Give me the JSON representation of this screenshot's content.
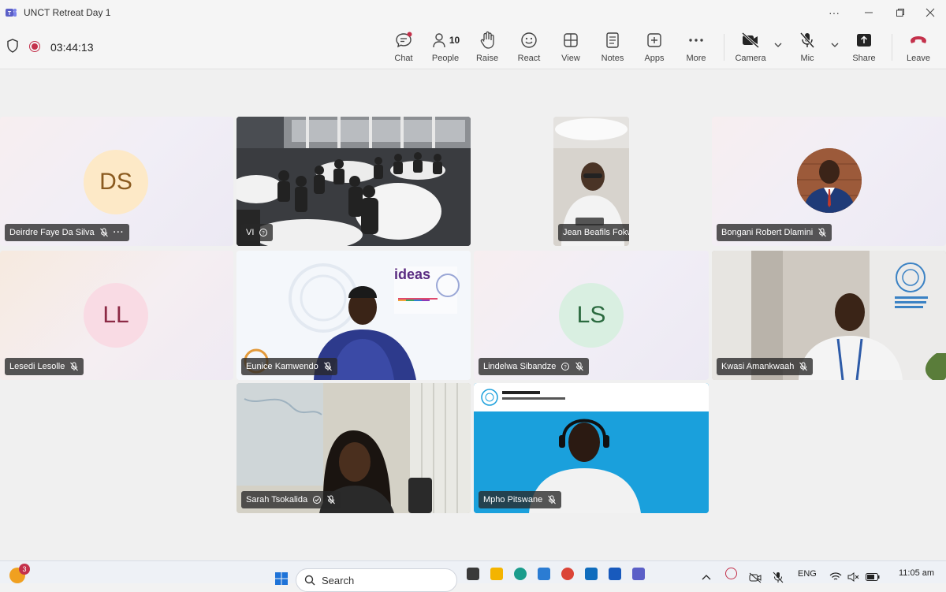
{
  "window": {
    "title": "UNCT Retreat Day 1"
  },
  "toolbar": {
    "timer": "03:44:13",
    "chat": "Chat",
    "people": "People",
    "people_count": "10",
    "raise": "Raise",
    "react": "React",
    "view": "View",
    "notes": "Notes",
    "apps": "Apps",
    "more": "More",
    "camera": "Camera",
    "mic": "Mic",
    "share": "Share",
    "leave": "Leave"
  },
  "participants": [
    {
      "name": "Deirdre Faye Da Silva",
      "initials": "DS",
      "avatar_bg": "#fde9c7",
      "avatar_fg": "#8a5a1f"
    },
    {
      "name": "VI"
    },
    {
      "name": "Jean Beafils Fokwa Tsafack"
    },
    {
      "name": "Bongani Robert Dlamini"
    },
    {
      "name": "Lesedi Lesolle",
      "initials": "LL",
      "avatar_bg": "#f9dbe4",
      "avatar_fg": "#8c2a45"
    },
    {
      "name": "Eunice Kamwendo"
    },
    {
      "name": "Lindelwa Sibandze",
      "initials": "LS",
      "avatar_bg": "#d9efe1",
      "avatar_fg": "#2b6a3f"
    },
    {
      "name": "Kwasi Amankwaah"
    },
    {
      "name": "Sarah Tsokalida"
    },
    {
      "name": "Mpho Pitswane"
    }
  ],
  "taskbar": {
    "search_placeholder": "Search",
    "notification_count": "3",
    "language": "ENG",
    "time": "11:05 am"
  },
  "colors": {
    "accent": "#5b5fc7",
    "leave": "#c4314b",
    "recording": "#c4314b"
  }
}
